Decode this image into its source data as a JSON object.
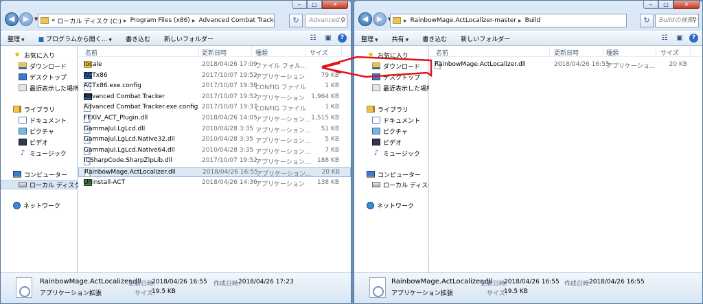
{
  "windows": [
    {
      "id": "acttracker",
      "title_controls": {
        "min": "–",
        "max": "□",
        "close": "✕"
      },
      "address": {
        "prefix": "«",
        "segments": [
          "ローカル ディスク (C:)",
          "Program Files (x86)",
          "Advanced Combat Tracker"
        ]
      },
      "search_placeholder": "Advanced...",
      "toolbar": {
        "organize": "整理",
        "open_with": "プログラムから開く...",
        "burn": "書き込む",
        "new_folder": "新しいフォルダー"
      },
      "nav": {
        "favorites": "お気に入り",
        "downloads": "ダウンロード",
        "desktop": "デスクトップ",
        "recent": "最近表示した場所",
        "libraries": "ライブラリ",
        "documents": "ドキュメント",
        "pictures": "ピクチャ",
        "videos": "ビデオ",
        "music": "ミュージック",
        "computer": "コンピューター",
        "local_disk": "ローカル ディスク",
        "network": "ネットワーク"
      },
      "columns": {
        "name": "名前",
        "date": "更新日時",
        "type": "種類",
        "size": "サイズ"
      },
      "files": [
        {
          "name": "locale",
          "date": "2018/04/26 17:09",
          "type": "ファイル フォル...",
          "size": "",
          "icon": "folder-icon"
        },
        {
          "name": "ACTx86",
          "date": "2017/10/07 19:52",
          "type": "アプリケーション",
          "size": "79 KB",
          "icon": "app-icon"
        },
        {
          "name": "ACTx86.exe.config",
          "date": "2017/10/07 19:38",
          "type": "CONFIG ファイル",
          "size": "1 KB",
          "icon": "config-file-icon"
        },
        {
          "name": "Advanced Combat Tracker",
          "date": "2017/10/07 19:52",
          "type": "アプリケーション",
          "size": "1,964 KB",
          "icon": "act-app-icon"
        },
        {
          "name": "Advanced Combat Tracker.exe.config",
          "date": "2017/10/07 19:37",
          "type": "CONFIG ファイル",
          "size": "1 KB",
          "icon": "config-file-icon"
        },
        {
          "name": "FFXIV_ACT_Plugin.dll",
          "date": "2018/04/26 14:05",
          "type": "アプリケーション...",
          "size": "1,515 KB",
          "icon": "dll-icon"
        },
        {
          "name": "GammaJul.LgLcd.dll",
          "date": "2010/04/28 3:35",
          "type": "アプリケーション...",
          "size": "51 KB",
          "icon": "dll-icon"
        },
        {
          "name": "GammaJul.LgLcd.Native32.dll",
          "date": "2010/04/28 3:35",
          "type": "アプリケーション...",
          "size": "5 KB",
          "icon": "dll-icon"
        },
        {
          "name": "GammaJul.LgLcd.Native64.dll",
          "date": "2010/04/28 3:35",
          "type": "アプリケーション...",
          "size": "7 KB",
          "icon": "dll-icon"
        },
        {
          "name": "ICSharpCode.SharpZipLib.dll",
          "date": "2017/10/07 19:52",
          "type": "アプリケーション...",
          "size": "188 KB",
          "icon": "dll-icon"
        },
        {
          "name": "RainbowMage.ActLocalizer.dll",
          "date": "2018/04/26 16:55",
          "type": "アプリケーション...",
          "size": "20 KB",
          "icon": "dll-icon",
          "selected": true
        },
        {
          "name": "Uninstall-ACT",
          "date": "2018/04/26 14:36",
          "type": "アプリケーション",
          "size": "138 KB",
          "icon": "uninstall-icon"
        }
      ],
      "details": {
        "filename": "RainbowMage.ActLocalizer.dll",
        "filetype": "アプリケーション拡張",
        "modified_label": "更新日時:",
        "modified": "2018/04/26 16:55",
        "created_label": "作成日時:",
        "created": "2018/04/26 17:23",
        "size_label": "サイズ:",
        "size": "19.5 KB"
      }
    },
    {
      "id": "build",
      "title_controls": {
        "min": "–",
        "max": "□",
        "close": "✕"
      },
      "address": {
        "prefix": "",
        "segments": [
          "RainbowMage.ActLocalizer-master",
          "Build"
        ]
      },
      "search_placeholder": "Buildの検索",
      "toolbar": {
        "organize": "整理",
        "share": "共有",
        "burn": "書き込む",
        "new_folder": "新しいフォルダー"
      },
      "nav": {
        "favorites": "お気に入り",
        "downloads": "ダウンロード",
        "desktop": "デスクトップ",
        "recent": "最近表示した場所",
        "libraries": "ライブラリ",
        "documents": "ドキュメント",
        "pictures": "ピクチャ",
        "videos": "ビデオ",
        "music": "ミュージック",
        "computer": "コンピューター",
        "local_disk": "ローカル ディスク",
        "network": "ネットワーク"
      },
      "columns": {
        "name": "名前",
        "date": "更新日時",
        "type": "種類",
        "size": "サイズ"
      },
      "files": [
        {
          "name": "RainbowMage.ActLocalizer.dll",
          "date": "2018/04/26 16:55",
          "type": "アプリケーショ...",
          "size": "20 KB",
          "icon": "dll-icon"
        }
      ],
      "details": {
        "filename": "RainbowMage.ActLocalizer.dll",
        "filetype": "アプリケーション拡張",
        "modified_label": "更新日時:",
        "modified": "2018/04/26 16:55",
        "created_label": "作成日時:",
        "created": "2018/04/26 16:55",
        "size_label": "サイズ:",
        "size": "19.5 KB"
      }
    }
  ],
  "annotation_color": "#e0141b"
}
